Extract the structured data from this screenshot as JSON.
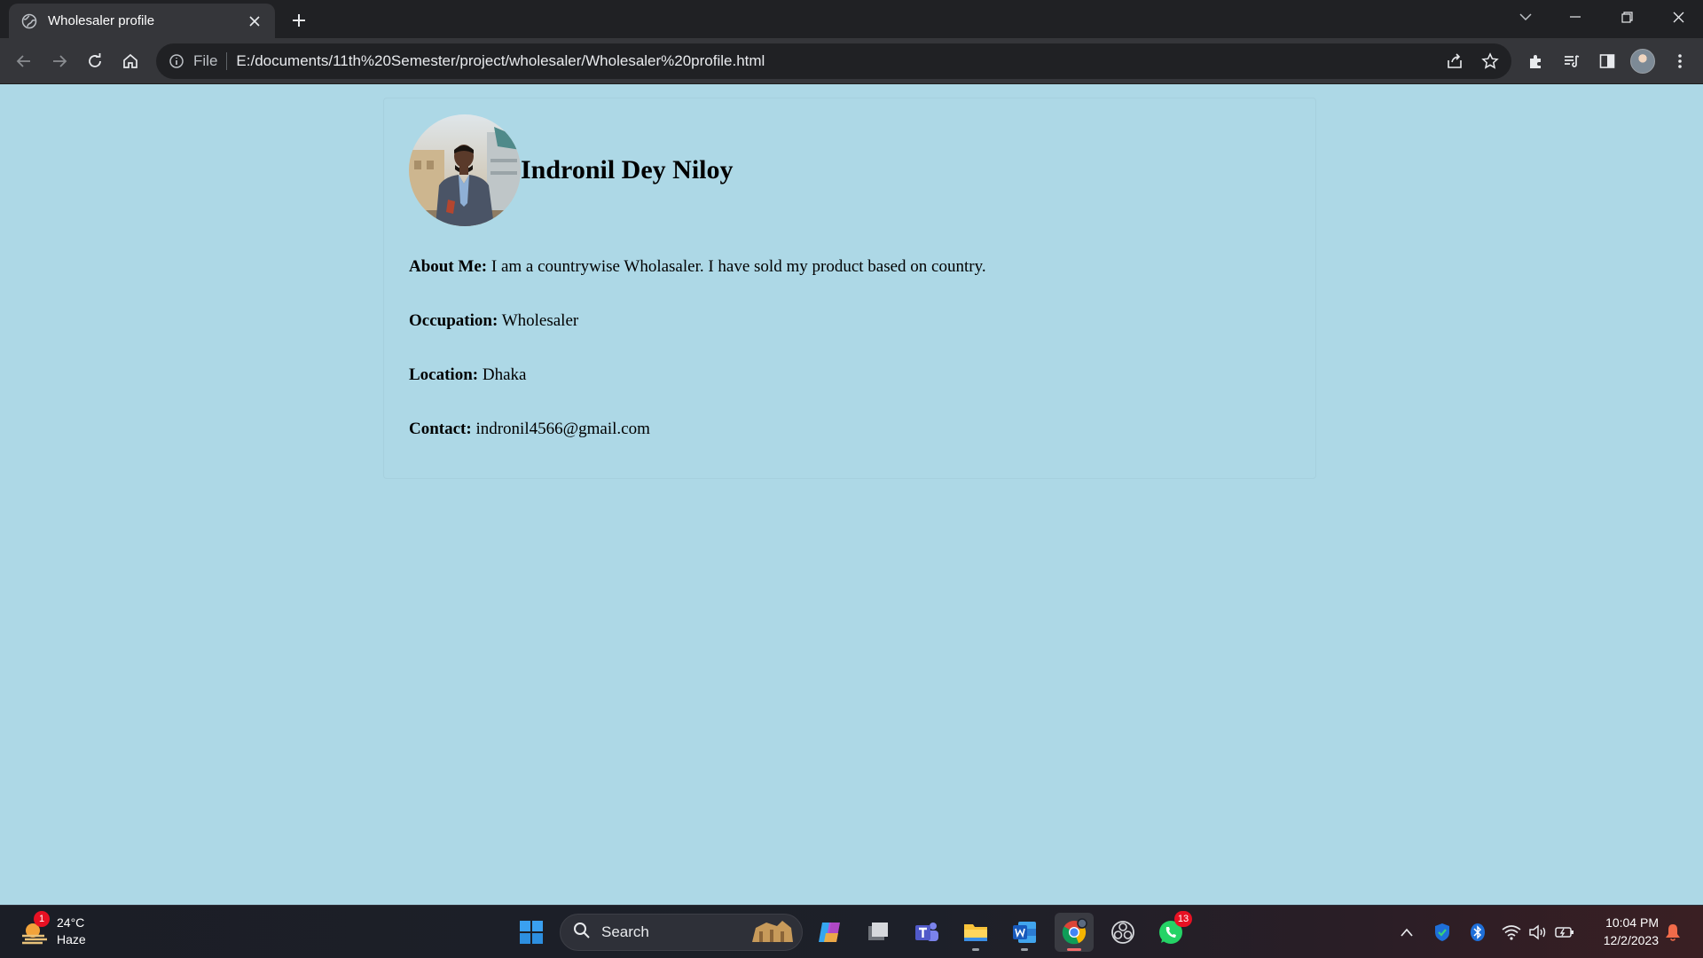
{
  "browser": {
    "tab": {
      "title": "Wholesaler profile"
    },
    "omnibox": {
      "scheme_label": "File",
      "url": "E:/documents/11th%20Semester/project/wholesaler/Wholesaler%20profile.html"
    }
  },
  "profile": {
    "name": "Indronil Dey Niloy",
    "fields": [
      {
        "label": "About Me:",
        "value": "I am a countrywise Wholasaler. I have sold my product based on country."
      },
      {
        "label": "Occupation:",
        "value": "Wholesaler"
      },
      {
        "label": "Location:",
        "value": "Dhaka"
      },
      {
        "label": "Contact:",
        "value": "indronil4566@gmail.com"
      }
    ]
  },
  "taskbar": {
    "weather": {
      "temperature": "24°C",
      "condition": "Haze",
      "badge": "1"
    },
    "search_label": "Search",
    "whatsapp_badge": "13",
    "clock": {
      "time": "10:04 PM",
      "date": "12/2/2023"
    }
  },
  "colors": {
    "page_background": "#add8e6",
    "browser_frame": "#202124",
    "toolbar": "#35363a",
    "active_tab_indicator": "#f26b6b"
  }
}
